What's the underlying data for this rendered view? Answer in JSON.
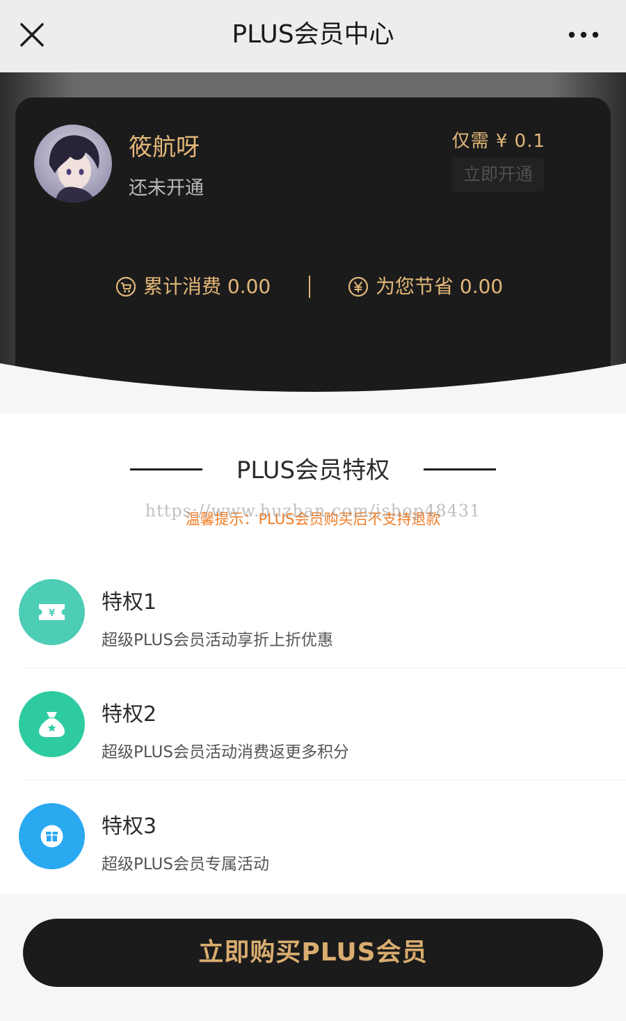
{
  "nav": {
    "title": "PLUS会员中心",
    "close_icon": "close-icon",
    "more_icon": "more-horizontal-icon"
  },
  "member_card": {
    "user_name": "筱航呀",
    "status": "还未开通",
    "price_label": "仅需 ¥ 0.1",
    "open_button": "立即开通",
    "total_spent_label": "累计消费 0.00",
    "saved_label": "为您节省 0.00",
    "total_spent_icon": "shopping-cart-icon",
    "saved_icon": "yen-coin-icon"
  },
  "privileges": {
    "title": "PLUS会员特权",
    "notice": "温馨提示：PLUS会员购买后不支持退款",
    "watermark": "https://www.huzhan.com/ishop48431",
    "items": [
      {
        "title": "特权1",
        "desc": "超级PLUS会员活动享折上折优惠",
        "icon": "coupon-icon",
        "color": "#4dcdb5"
      },
      {
        "title": "特权2",
        "desc": "超级PLUS会员活动消费返更多积分",
        "icon": "money-bag-icon",
        "color": "#2ecba1"
      },
      {
        "title": "特权3",
        "desc": "超级PLUS会员专属活动",
        "icon": "gift-icon",
        "color": "#2aa9f1"
      }
    ]
  },
  "buy_button": "立即购买PLUS会员",
  "colors": {
    "gold": "#e3b779",
    "card_bg": "#1b1b1b",
    "notice": "#f07d27"
  }
}
